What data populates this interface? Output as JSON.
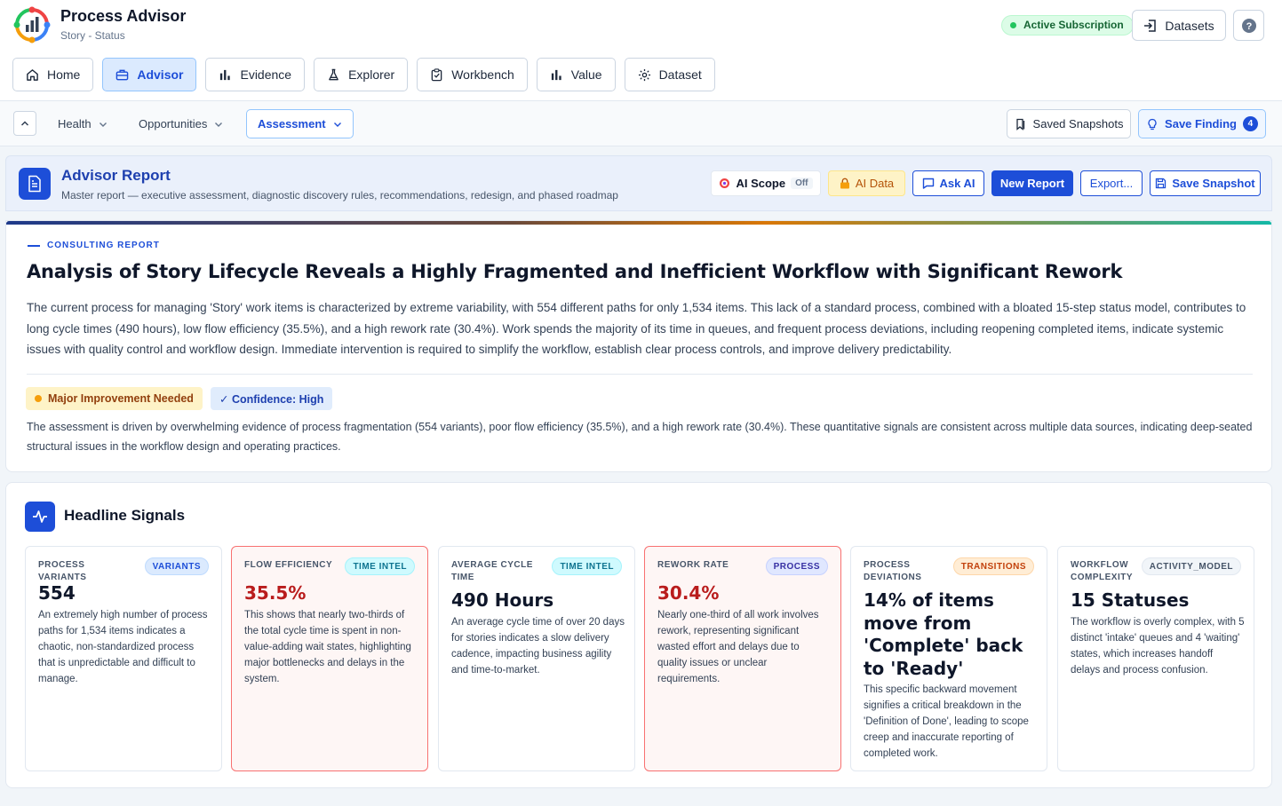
{
  "app": {
    "title": "Process Advisor",
    "subtitle": "Story - Status"
  },
  "header": {
    "subscription": "Active Subscription",
    "datasets_label": "Datasets",
    "help_label": "?"
  },
  "nav": {
    "tabs": [
      {
        "label": "Home",
        "icon": "home-icon"
      },
      {
        "label": "Advisor",
        "icon": "briefcase-icon",
        "active": true
      },
      {
        "label": "Evidence",
        "icon": "bar-chart-icon"
      },
      {
        "label": "Explorer",
        "icon": "flask-icon"
      },
      {
        "label": "Workbench",
        "icon": "clipboard-check-icon"
      },
      {
        "label": "Value",
        "icon": "bar-chart-icon"
      },
      {
        "label": "Dataset",
        "icon": "gear-icon"
      }
    ]
  },
  "subnav": {
    "tabs": [
      {
        "label": "Health"
      },
      {
        "label": "Opportunities"
      },
      {
        "label": "Assessment",
        "active": true
      }
    ],
    "saved_snapshots": "Saved Snapshots",
    "save_finding": "Save Finding",
    "finding_count": "4"
  },
  "report": {
    "title": "Advisor Report",
    "subtitle": "Master report — executive assessment, diagnostic discovery rules, recommendations, redesign, and phased roadmap",
    "ai_scope": "AI Scope",
    "ai_scope_state": "Off",
    "ai_data": "AI Data",
    "ask_ai": "Ask AI",
    "new_report": "New Report",
    "export": "Export...",
    "save_snapshot": "Save Snapshot"
  },
  "consulting": {
    "eyebrow": "CONSULTING REPORT",
    "headline": "Analysis of Story Lifecycle Reveals a Highly Fragmented and Inefficient Workflow with Significant Rework",
    "summary": "The current process for managing 'Story' work items is characterized by extreme variability, with 554 different paths for only 1,534 items. This lack of a standard process, combined with a bloated 15-step status model, contributes to long cycle times (490 hours), low flow efficiency (35.5%), and a high rework rate (30.4%). Work spends the majority of its time in queues, and frequent process deviations, including reopening completed items, indicate systemic issues with quality control and workflow design. Immediate intervention is required to simplify the workflow, establish clear process controls, and improve delivery predictability.",
    "rating": "Major Improvement Needed",
    "confidence": "✓ Confidence: High",
    "assessment": "The assessment is driven by overwhelming evidence of process fragmentation (554 variants), poor flow efficiency (35.5%), and a high rework rate (30.4%). These quantitative signals are consistent across multiple data sources, indicating deep-seated structural issues in the workflow design and operating practices."
  },
  "signals": {
    "title": "Headline Signals",
    "cards": [
      {
        "label": "PROCESS VARIANTS",
        "tag": "VARIANTS",
        "value": "554",
        "desc": "An extremely high number of process paths for 1,534 items indicates a chaotic, non-standardized process that is unpredictable and difficult to manage."
      },
      {
        "label": "FLOW EFFICIENCY",
        "tag": "TIME INTEL",
        "value": "35.5%",
        "desc": "This shows that nearly two-thirds of the total cycle time is spent in non-value-adding wait states, highlighting major bottlenecks and delays in the system."
      },
      {
        "label": "AVERAGE CYCLE TIME",
        "tag": "TIME INTEL",
        "value": "490 Hours",
        "desc": "An average cycle time of over 20 days for stories indicates a slow delivery cadence, impacting business agility and time-to-market."
      },
      {
        "label": "REWORK RATE",
        "tag": "PROCESS",
        "value": "30.4%",
        "desc": "Nearly one-third of all work involves rework, representing significant wasted effort and delays due to quality issues or unclear requirements."
      },
      {
        "label": "PROCESS DEVIATIONS",
        "tag": "TRANSITIONS",
        "value": "14% of items move from 'Complete' back to 'Ready'",
        "desc": "This specific backward movement signifies a critical breakdown in the 'Definition of Done', leading to scope creep and inaccurate reporting of completed work."
      },
      {
        "label": "WORKFLOW COMPLEXITY",
        "tag": "ACTIVITY_MODEL",
        "value": "15 Statuses",
        "desc": "The workflow is overly complex, with 5 distinct 'intake' queues and 4 'waiting' states, which increases handoff delays and process confusion."
      }
    ]
  }
}
